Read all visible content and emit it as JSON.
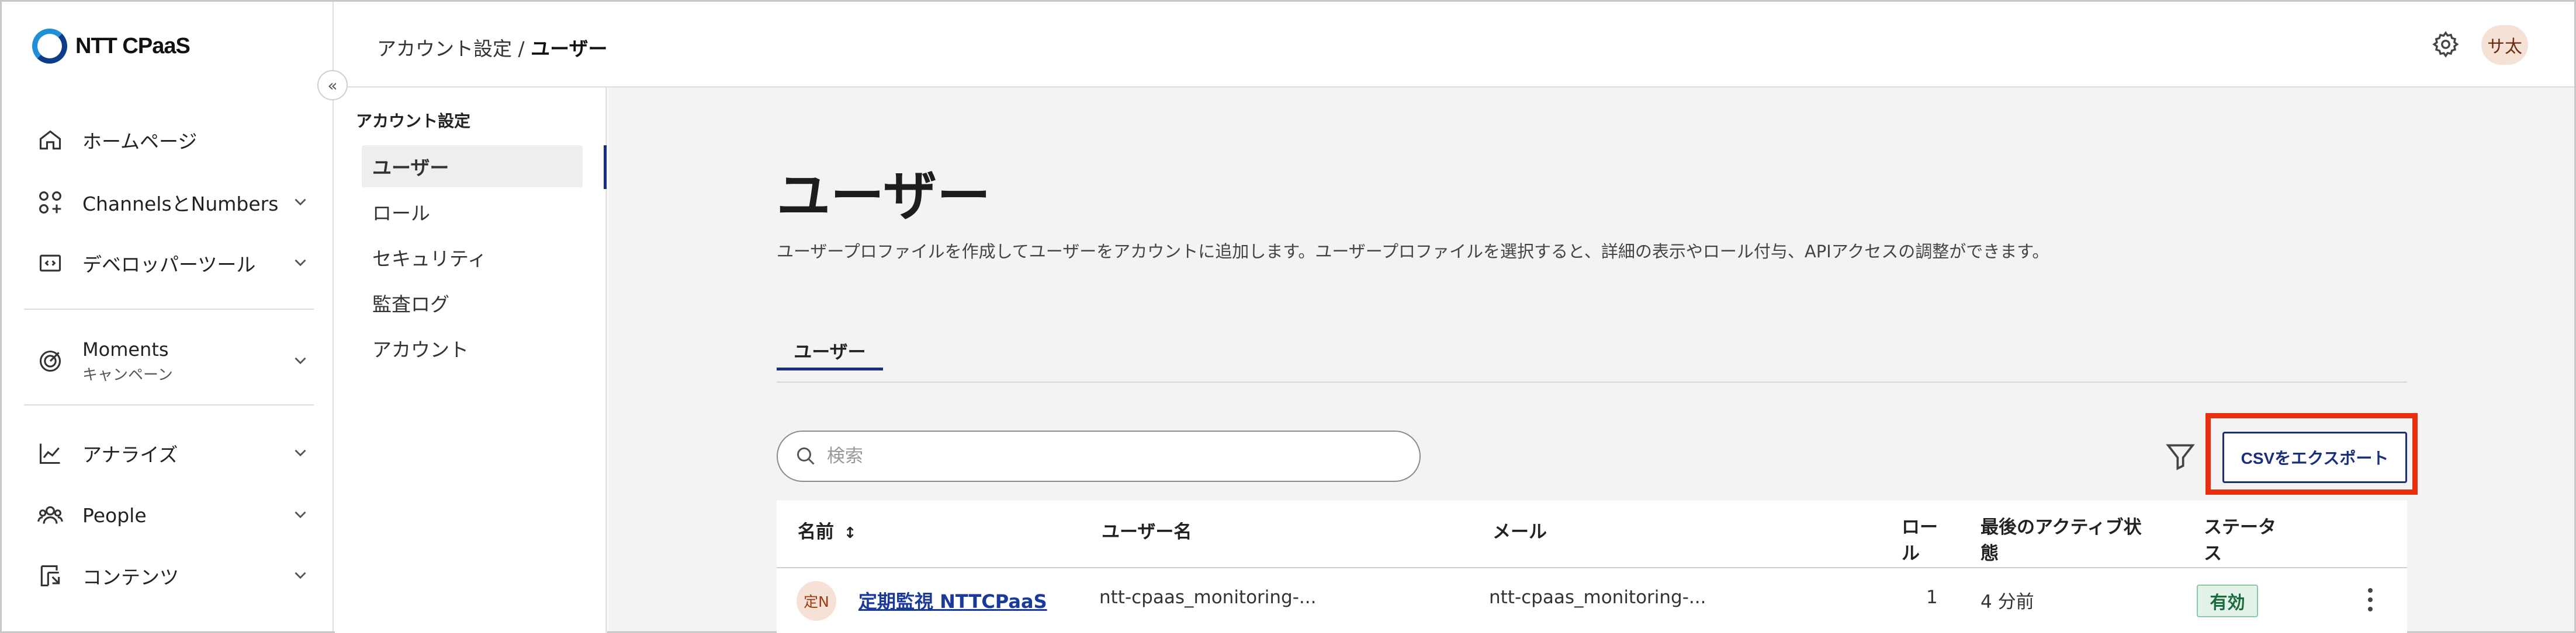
{
  "app": {
    "logo_text": "NTT CPaaS"
  },
  "header": {
    "breadcrumb_parent": "アカウント設定 / ",
    "breadcrumb_current": "ユーザー",
    "avatar_initials": "サ太"
  },
  "sidebar": {
    "items": [
      {
        "label": "ホームページ",
        "icon": "home-icon"
      },
      {
        "label": "ChannelsとNumbers",
        "icon": "channels-icon"
      },
      {
        "label": "デベロッパーツール",
        "icon": "code-icon"
      },
      {
        "label": "Moments",
        "sublabel": "キャンペーン",
        "icon": "target-icon"
      },
      {
        "label": "アナライズ",
        "icon": "chart-icon"
      },
      {
        "label": "People",
        "icon": "people-icon"
      },
      {
        "label": "コンテンツ",
        "icon": "content-icon"
      }
    ]
  },
  "subnav": {
    "title": "アカウント設定",
    "items": [
      "ユーザー",
      "ロール",
      "セキュリティ",
      "監査ログ",
      "アカウント"
    ]
  },
  "main": {
    "title": "ユーザー",
    "description": "ユーザープロファイルを作成してユーザーをアカウントに追加します。ユーザープロファイルを選択すると、詳細の表示やロール付与、APIアクセスの調整ができます。",
    "tab": "ユーザー",
    "search_placeholder": "検索",
    "export_label": "CSVをエクスポート"
  },
  "table": {
    "columns": [
      "名前",
      "ユーザー名",
      "メール",
      "ロール",
      "最後のアクティブ状態",
      "ステータス"
    ],
    "column_lines": {
      "role": [
        "ロー",
        "ル"
      ],
      "last_active": [
        "最後のアクティブ状",
        "態"
      ],
      "status": [
        "ステータ",
        "ス"
      ]
    },
    "sort_icon": "↕",
    "rows": [
      {
        "avatar": "定N",
        "name": "定期監視 NTTCPaaS",
        "username": "ntt-cpaas_monitoring-...",
        "email": "ntt-cpaas_monitoring-...",
        "role": "1",
        "last_active": "4 分前",
        "status": "有効"
      }
    ]
  },
  "colors": {
    "accent": "#1a2f7a",
    "highlight": "#e83010",
    "status_green": "#1b6b3e"
  }
}
